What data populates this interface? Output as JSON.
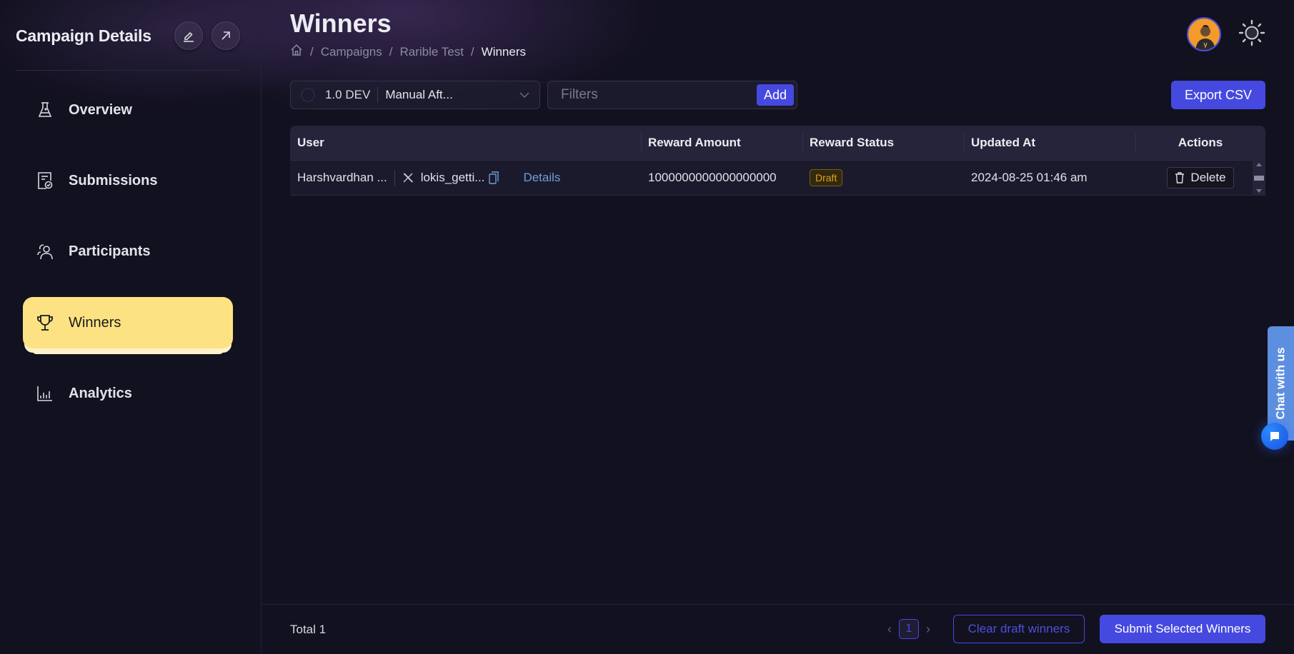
{
  "sidebar": {
    "title": "Campaign Details",
    "actions": [
      {
        "icon": "pencil-icon",
        "label": "Edit"
      },
      {
        "icon": "external-link-icon",
        "label": "Open"
      }
    ],
    "items": [
      {
        "label": "Overview",
        "icon": "flask-icon",
        "active": false
      },
      {
        "label": "Submissions",
        "icon": "submissions-icon",
        "active": false
      },
      {
        "label": "Participants",
        "icon": "users-icon",
        "active": false
      },
      {
        "label": "Winners",
        "icon": "trophy-icon",
        "active": true
      },
      {
        "label": "Analytics",
        "icon": "bar-chart-icon",
        "active": false
      }
    ]
  },
  "header": {
    "title": "Winners",
    "breadcrumb": [
      "Campaigns",
      "Rarible Test",
      "Winners"
    ]
  },
  "toolbar": {
    "version": "1.0 DEV",
    "selected_mode": "Manual Aft...",
    "filter_placeholder": "Filters",
    "add_label": "Add",
    "export_label": "Export CSV"
  },
  "table": {
    "columns": [
      "User",
      "Reward Amount",
      "Reward Status",
      "Updated At",
      "Actions"
    ],
    "rows": [
      {
        "user": "Harshvardhan ...",
        "handle": "lokis_getti...",
        "details_label": "Details",
        "reward_amount": "1000000000000000000",
        "status": "Draft",
        "updated_at": "2024-08-25 01:46 am",
        "action_label": "Delete"
      }
    ]
  },
  "footer": {
    "total": "Total 1",
    "current_page": "1",
    "clear_label": "Clear draft winners",
    "submit_label": "Submit Selected Winners"
  },
  "chat": {
    "label": "Chat with us"
  },
  "colors": {
    "accent": "#4549e0",
    "active_nav": "#fde283",
    "draft": "#e3a01d",
    "link": "#6e9fd6"
  }
}
